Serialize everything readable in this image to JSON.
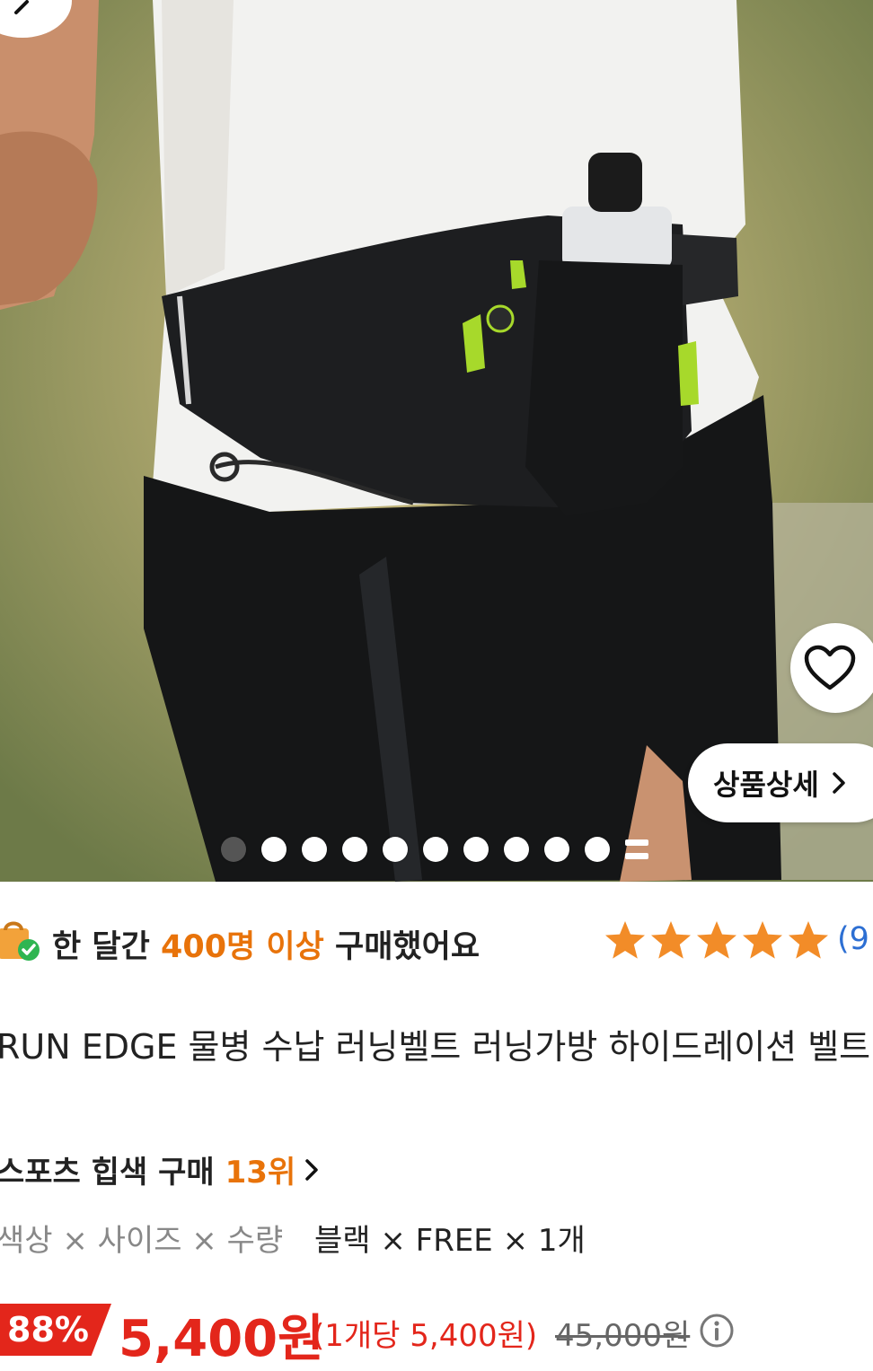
{
  "hero": {
    "image_desc_icon": "product-photo",
    "detail_button_label": "상품상세",
    "carousel": {
      "total_dots": 10,
      "active_index": 0
    }
  },
  "purchase_stat": {
    "prefix": "한 달간 ",
    "highlight": "400명 이상",
    "suffix": " 구매했어요"
  },
  "rating": {
    "stars": 5,
    "review_count_visible": "(9"
  },
  "product": {
    "title": "RUN EDGE 물병 수납 러닝벨트 러닝가방 하이드레이션 벨트"
  },
  "ranking": {
    "label": "스포츠 힙색 구매",
    "rank": "13위"
  },
  "options": {
    "labels": "색상 × 사이즈 × 수량",
    "values": "블랙 × FREE × 1개"
  },
  "pricing": {
    "discount": "88%",
    "price": "5,400원",
    "unit_price": "(1개당 5,400원)",
    "original_price": "45,000원"
  },
  "colors": {
    "accent_orange": "#e8730a",
    "sale_red": "#e3261b",
    "star": "#f28c28",
    "link_blue": "#2d6fd3"
  }
}
